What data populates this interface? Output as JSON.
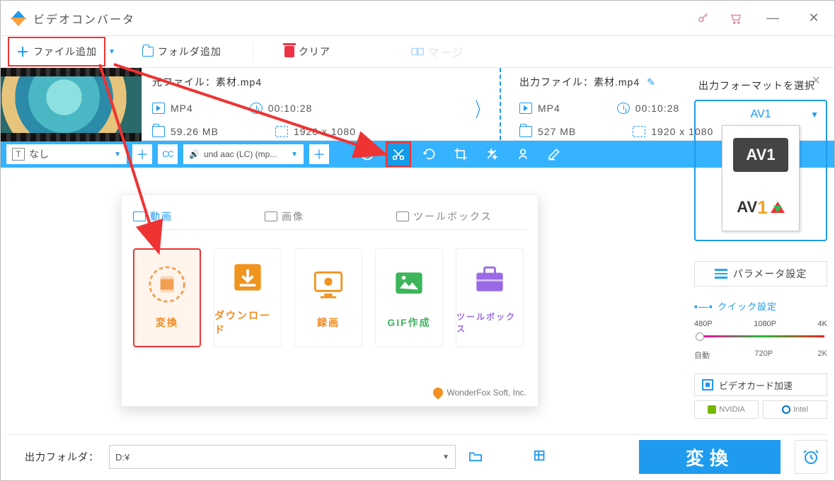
{
  "app": {
    "title": "ビデオコンバータ"
  },
  "toolbar": {
    "add_file": "ファイル追加",
    "add_folder": "フォルダ追加",
    "clear": "クリア",
    "merge": "マージ"
  },
  "file": {
    "source_label": "元ファイル：",
    "source_name": "素材.mp4",
    "output_label": "出力ファイル：",
    "output_name": "素材.mp4",
    "src": {
      "format": "MP4",
      "duration": "00:10:28",
      "size": "59.26 MB",
      "resolution": "1920 x 1080"
    },
    "out": {
      "format": "MP4",
      "duration": "00:10:28",
      "size": "527 MB",
      "resolution": "1920 x 1080"
    }
  },
  "bluestrip": {
    "subtitle_select": "なし",
    "audio_select": "und aac (LC) (mp..."
  },
  "card": {
    "tab_video": "動画",
    "tab_image": "画像",
    "tab_tools": "ツールボックス",
    "items": {
      "convert": "変換",
      "download": "ダウンロード",
      "record": "録画",
      "gif": "GIF作成",
      "toolbox": "ツールボックス"
    },
    "credit": "WonderFox Soft, Inc."
  },
  "right": {
    "title": "出力フォーマットを選択",
    "format_name": "AV1",
    "format_badge": "AV1",
    "format_logo": "AV",
    "param_btn": "パラメータ設定",
    "quick_title": "クイック設定",
    "presets_top": {
      "p1": "480P",
      "p2": "1080P",
      "p3": "4K"
    },
    "presets_bot": {
      "p1": "自動",
      "p2": "720P",
      "p3": "2K"
    },
    "gpu_btn": "ビデオカード加速",
    "gpu_nvidia": "NVIDIA",
    "gpu_intel": "Intel"
  },
  "bottom": {
    "out_label": "出力フォルダ：",
    "out_path": "D:¥",
    "convert": "変換"
  }
}
